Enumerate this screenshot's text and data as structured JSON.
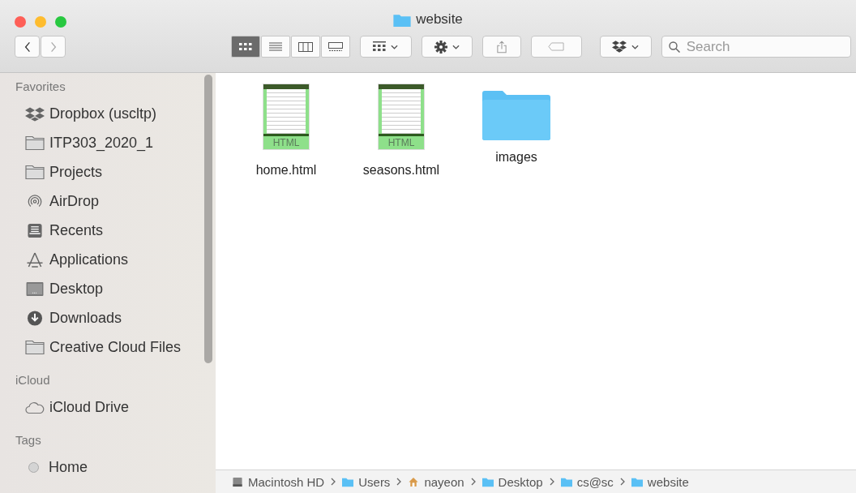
{
  "window": {
    "title": "website"
  },
  "toolbar": {
    "view_modes": [
      {
        "kind": "icons",
        "selected": true
      },
      {
        "kind": "list",
        "selected": false
      },
      {
        "kind": "columns",
        "selected": false
      },
      {
        "kind": "gallery",
        "selected": false
      }
    ],
    "search": {
      "placeholder": "Search"
    }
  },
  "sidebar": {
    "sections": [
      {
        "title": "Favorites",
        "items": [
          {
            "label": "Dropbox (uscltp)",
            "kind": "dropbox"
          },
          {
            "label": "ITP303_2020_1",
            "kind": "folder"
          },
          {
            "label": "Projects",
            "kind": "folder"
          },
          {
            "label": "AirDrop",
            "kind": "airdrop"
          },
          {
            "label": "Recents",
            "kind": "recents"
          },
          {
            "label": "Applications",
            "kind": "applications"
          },
          {
            "label": "Desktop",
            "kind": "desktop"
          },
          {
            "label": "Downloads",
            "kind": "downloads"
          },
          {
            "label": "Creative Cloud Files",
            "kind": "folder"
          }
        ]
      },
      {
        "title": "iCloud",
        "items": [
          {
            "label": "iCloud Drive",
            "kind": "cloud"
          }
        ]
      },
      {
        "title": "Tags",
        "items": [
          {
            "label": "Home",
            "kind": "tag",
            "color": "#d4d4d4"
          }
        ]
      }
    ]
  },
  "files": [
    {
      "name": "home.html",
      "kind": "html",
      "badge": "HTML"
    },
    {
      "name": "seasons.html",
      "kind": "html",
      "badge": "HTML"
    },
    {
      "name": "images",
      "kind": "folder"
    }
  ],
  "path_bar": [
    {
      "label": "Macintosh HD",
      "kind": "disk"
    },
    {
      "label": "Users",
      "kind": "folder"
    },
    {
      "label": "nayeon",
      "kind": "home"
    },
    {
      "label": "Desktop",
      "kind": "folder"
    },
    {
      "label": "cs@sc",
      "kind": "folder"
    },
    {
      "label": "website",
      "kind": "folder"
    }
  ]
}
